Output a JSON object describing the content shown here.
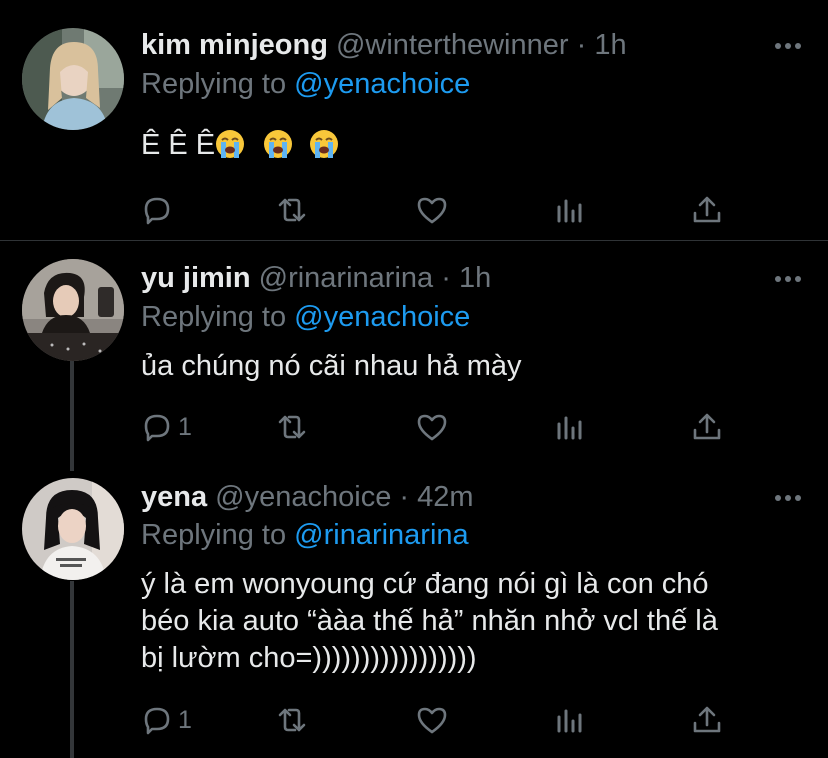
{
  "tweets": [
    {
      "display_name": "kim minjeong",
      "handle": "@winterthewinner",
      "time": "1h",
      "replying_prefix": "Replying to",
      "replying_to": "@yenachoice",
      "text": "Ê Ê Ê",
      "emojis": [
        "loudly-crying-face-emoji",
        "loudly-crying-face-emoji",
        "loudly-crying-face-emoji"
      ],
      "reply_count": ""
    },
    {
      "display_name": "yu jimin",
      "handle": "@rinarinarina",
      "time": "1h",
      "replying_prefix": "Replying to",
      "replying_to": "@yenachoice",
      "text": "ủa chúng nó cãi nhau hả mày",
      "reply_count": "1"
    },
    {
      "display_name": "yena",
      "handle": "@yenachoice",
      "time": "42m",
      "replying_prefix": "Replying to",
      "replying_to": "@rinarinarina",
      "text_lines": [
        "ý là em wonyoung cứ đang nói gì là con chó",
        "béo kia auto “ààa thế hả” nhăn nhở vcl thế là",
        "bị lườm cho=)))))))))))))))))"
      ],
      "reply_count": "1"
    }
  ],
  "separator": "·",
  "colors": {
    "background": "#000000",
    "muted": "#6e767d",
    "link": "#1d9bf0",
    "divider": "#2f3336"
  }
}
